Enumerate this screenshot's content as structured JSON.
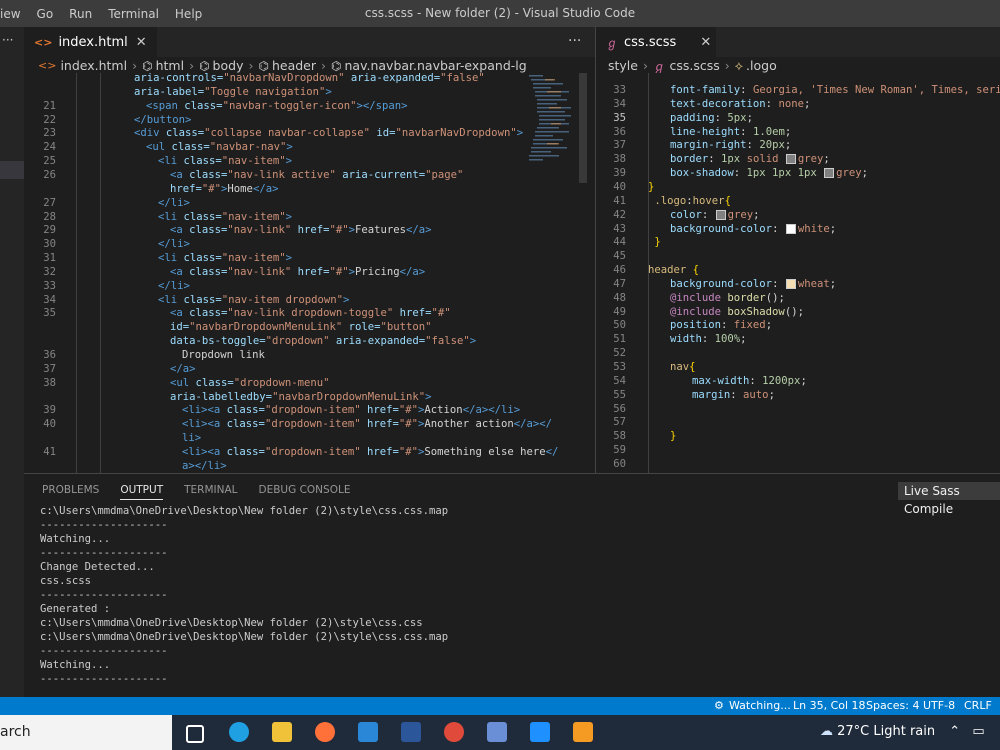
{
  "menu": [
    "iew",
    "Go",
    "Run",
    "Terminal",
    "Help"
  ],
  "window_title": "css.scss - New folder (2) - Visual Studio Code",
  "left_editor": {
    "tab_label": "index.html",
    "close_glyph": "✕",
    "more_glyph": "···",
    "breadcrumb": [
      "index.html",
      "html",
      "body",
      "header",
      "nav.navbar.navbar-expand-lg"
    ],
    "lines": [
      {
        "n": "",
        "indent": 0,
        "tokens": [
          [
            "at",
            "aria-controls="
          ],
          [
            "st",
            "\"navbarNavDropdown\""
          ],
          [
            "at",
            " aria-expanded="
          ],
          [
            "st",
            "\"false\""
          ]
        ]
      },
      {
        "n": "",
        "indent": 0,
        "tokens": [
          [
            "at",
            "aria-label="
          ],
          [
            "st",
            "\"Toggle navigation\""
          ],
          [
            "tg",
            ">"
          ]
        ]
      },
      {
        "n": "21",
        "indent": 1,
        "tokens": [
          [
            "tg",
            "<span "
          ],
          [
            "at",
            "class="
          ],
          [
            "st",
            "\"navbar-toggler-icon\""
          ],
          [
            "tg",
            "></span>"
          ]
        ]
      },
      {
        "n": "22",
        "indent": 0,
        "tokens": [
          [
            "tg",
            "</button>"
          ]
        ]
      },
      {
        "n": "23",
        "indent": 0,
        "tokens": [
          [
            "tg",
            "<div "
          ],
          [
            "at",
            "class="
          ],
          [
            "st",
            "\"collapse navbar-collapse\""
          ],
          [
            "at",
            " id="
          ],
          [
            "st",
            "\"navbarNavDropdown\""
          ],
          [
            "tg",
            ">"
          ]
        ]
      },
      {
        "n": "24",
        "indent": 1,
        "tokens": [
          [
            "tg",
            "<ul "
          ],
          [
            "at",
            "class="
          ],
          [
            "st",
            "\"navbar-nav\""
          ],
          [
            "tg",
            ">"
          ]
        ]
      },
      {
        "n": "25",
        "indent": 2,
        "tokens": [
          [
            "tg",
            "<li "
          ],
          [
            "at",
            "class="
          ],
          [
            "st",
            "\"nav-item\""
          ],
          [
            "tg",
            ">"
          ]
        ]
      },
      {
        "n": "26",
        "indent": 3,
        "tokens": [
          [
            "tg",
            "<a "
          ],
          [
            "at",
            "class="
          ],
          [
            "st",
            "\"nav-link active\""
          ],
          [
            "at",
            " aria-current="
          ],
          [
            "st",
            "\"page\""
          ]
        ]
      },
      {
        "n": "",
        "indent": 3,
        "tokens": [
          [
            "at",
            "href="
          ],
          [
            "st",
            "\"#\""
          ],
          [
            "tg",
            ">"
          ],
          [
            "pl",
            "Home"
          ],
          [
            "tg",
            "</a>"
          ]
        ]
      },
      {
        "n": "27",
        "indent": 2,
        "tokens": [
          [
            "tg",
            "</li>"
          ]
        ]
      },
      {
        "n": "28",
        "indent": 2,
        "tokens": [
          [
            "tg",
            "<li "
          ],
          [
            "at",
            "class="
          ],
          [
            "st",
            "\"nav-item\""
          ],
          [
            "tg",
            ">"
          ]
        ]
      },
      {
        "n": "29",
        "indent": 3,
        "tokens": [
          [
            "tg",
            "<a "
          ],
          [
            "at",
            "class="
          ],
          [
            "st",
            "\"nav-link\""
          ],
          [
            "at",
            " href="
          ],
          [
            "st",
            "\"#\""
          ],
          [
            "tg",
            ">"
          ],
          [
            "pl",
            "Features"
          ],
          [
            "tg",
            "</a>"
          ]
        ]
      },
      {
        "n": "30",
        "indent": 2,
        "tokens": [
          [
            "tg",
            "</li>"
          ]
        ]
      },
      {
        "n": "31",
        "indent": 2,
        "tokens": [
          [
            "tg",
            "<li "
          ],
          [
            "at",
            "class="
          ],
          [
            "st",
            "\"nav-item\""
          ],
          [
            "tg",
            ">"
          ]
        ]
      },
      {
        "n": "32",
        "indent": 3,
        "tokens": [
          [
            "tg",
            "<a "
          ],
          [
            "at",
            "class="
          ],
          [
            "st",
            "\"nav-link\""
          ],
          [
            "at",
            " href="
          ],
          [
            "st",
            "\"#\""
          ],
          [
            "tg",
            ">"
          ],
          [
            "pl",
            "Pricing"
          ],
          [
            "tg",
            "</a>"
          ]
        ]
      },
      {
        "n": "33",
        "indent": 2,
        "tokens": [
          [
            "tg",
            "</li>"
          ]
        ]
      },
      {
        "n": "34",
        "indent": 2,
        "tokens": [
          [
            "tg",
            "<li "
          ],
          [
            "at",
            "class="
          ],
          [
            "st",
            "\"nav-item dropdown\""
          ],
          [
            "tg",
            ">"
          ]
        ]
      },
      {
        "n": "35",
        "indent": 3,
        "tokens": [
          [
            "tg",
            "<a "
          ],
          [
            "at",
            "class="
          ],
          [
            "st",
            "\"nav-link dropdown-toggle\""
          ],
          [
            "at",
            " href="
          ],
          [
            "st",
            "\"#\""
          ]
        ]
      },
      {
        "n": "",
        "indent": 3,
        "tokens": [
          [
            "at",
            "id="
          ],
          [
            "st",
            "\"navbarDropdownMenuLink\""
          ],
          [
            "at",
            " role="
          ],
          [
            "st",
            "\"button\""
          ]
        ]
      },
      {
        "n": "",
        "indent": 3,
        "tokens": [
          [
            "at",
            "data-bs-toggle="
          ],
          [
            "st",
            "\"dropdown\""
          ],
          [
            "at",
            " aria-expanded="
          ],
          [
            "st",
            "\"false\""
          ],
          [
            "tg",
            ">"
          ]
        ]
      },
      {
        "n": "36",
        "indent": 4,
        "tokens": [
          [
            "pl",
            "Dropdown link"
          ]
        ]
      },
      {
        "n": "37",
        "indent": 3,
        "tokens": [
          [
            "tg",
            "</a>"
          ]
        ]
      },
      {
        "n": "38",
        "indent": 3,
        "tokens": [
          [
            "tg",
            "<ul "
          ],
          [
            "at",
            "class="
          ],
          [
            "st",
            "\"dropdown-menu\""
          ]
        ]
      },
      {
        "n": "",
        "indent": 3,
        "tokens": [
          [
            "at",
            "aria-labelledby="
          ],
          [
            "st",
            "\"navbarDropdownMenuLink\""
          ],
          [
            "tg",
            ">"
          ]
        ]
      },
      {
        "n": "39",
        "indent": 4,
        "tokens": [
          [
            "tg",
            "<li><a "
          ],
          [
            "at",
            "class="
          ],
          [
            "st",
            "\"dropdown-item\""
          ],
          [
            "at",
            " href="
          ],
          [
            "st",
            "\"#\""
          ],
          [
            "tg",
            ">"
          ],
          [
            "pl",
            "Action"
          ],
          [
            "tg",
            "</a></li>"
          ]
        ]
      },
      {
        "n": "40",
        "indent": 4,
        "tokens": [
          [
            "tg",
            "<li><a "
          ],
          [
            "at",
            "class="
          ],
          [
            "st",
            "\"dropdown-item\""
          ],
          [
            "at",
            " href="
          ],
          [
            "st",
            "\"#\""
          ],
          [
            "tg",
            ">"
          ],
          [
            "pl",
            "Another action"
          ],
          [
            "tg",
            "</a></"
          ]
        ]
      },
      {
        "n": "",
        "indent": 4,
        "tokens": [
          [
            "tg",
            "li>"
          ]
        ]
      },
      {
        "n": "41",
        "indent": 4,
        "tokens": [
          [
            "tg",
            "<li><a "
          ],
          [
            "at",
            "class="
          ],
          [
            "st",
            "\"dropdown-item\""
          ],
          [
            "at",
            " href="
          ],
          [
            "st",
            "\"#\""
          ],
          [
            "tg",
            ">"
          ],
          [
            "pl",
            "Something else here"
          ],
          [
            "tg",
            "</"
          ]
        ]
      },
      {
        "n": "",
        "indent": 4,
        "tokens": [
          [
            "tg",
            "a></li>"
          ]
        ]
      }
    ]
  },
  "right_editor": {
    "tab_label": "css.scss",
    "close_glyph": "✕",
    "breadcrumb": [
      "style",
      "css.scss",
      ".logo"
    ],
    "lines": [
      {
        "n": "33",
        "indent": 1,
        "tokens": [
          [
            "prop",
            "font-family"
          ],
          [
            "pl",
            ": "
          ],
          [
            "val",
            "Georgia, 'Times New Roman', Times, serif"
          ],
          [
            "pl",
            ";"
          ]
        ]
      },
      {
        "n": "34",
        "indent": 1,
        "tokens": [
          [
            "prop",
            "text-decoration"
          ],
          [
            "pl",
            ": "
          ],
          [
            "val",
            "none"
          ],
          [
            "pl",
            ";"
          ]
        ]
      },
      {
        "n": "35",
        "indent": 1,
        "tokens": [
          [
            "prop",
            "padding"
          ],
          [
            "pl",
            ": "
          ],
          [
            "num",
            "5px"
          ],
          [
            "pl",
            ";"
          ]
        ]
      },
      {
        "n": "36",
        "indent": 1,
        "tokens": [
          [
            "prop",
            "line-height"
          ],
          [
            "pl",
            ": "
          ],
          [
            "num",
            "1.0em"
          ],
          [
            "pl",
            ";"
          ]
        ]
      },
      {
        "n": "37",
        "indent": 1,
        "tokens": [
          [
            "prop",
            "margin-right"
          ],
          [
            "pl",
            ": "
          ],
          [
            "num",
            "20px"
          ],
          [
            "pl",
            ";"
          ]
        ]
      },
      {
        "n": "38",
        "indent": 1,
        "tokens": [
          [
            "prop",
            "border"
          ],
          [
            "pl",
            ": "
          ],
          [
            "num",
            "1px "
          ],
          [
            "val",
            "solid "
          ],
          [
            "swatch",
            "#808080"
          ],
          [
            "val",
            "grey"
          ],
          [
            "pl",
            ";"
          ]
        ]
      },
      {
        "n": "39",
        "indent": 1,
        "tokens": [
          [
            "prop",
            "box-shadow"
          ],
          [
            "pl",
            ": "
          ],
          [
            "num",
            "1px 1px 1px "
          ],
          [
            "swatch",
            "#808080"
          ],
          [
            "val",
            "grey"
          ],
          [
            "pl",
            ";"
          ]
        ]
      },
      {
        "n": "40",
        "indent": 0,
        "tokens": [
          [
            "br",
            "}"
          ]
        ]
      },
      {
        "n": "41",
        "indent": 0,
        "tokens": [
          [
            "sel",
            " .logo"
          ],
          [
            "pl",
            ":"
          ],
          [
            "sel",
            "hover"
          ],
          [
            "br",
            "{"
          ]
        ]
      },
      {
        "n": "42",
        "indent": 1,
        "tokens": [
          [
            "prop",
            "color"
          ],
          [
            "pl",
            ": "
          ],
          [
            "swatch",
            "#808080"
          ],
          [
            "val",
            "grey"
          ],
          [
            "pl",
            ";"
          ]
        ]
      },
      {
        "n": "43",
        "indent": 1,
        "tokens": [
          [
            "prop",
            "background-color"
          ],
          [
            "pl",
            ": "
          ],
          [
            "swatch",
            "#ffffff"
          ],
          [
            "val",
            "white"
          ],
          [
            "pl",
            ";"
          ]
        ]
      },
      {
        "n": "44",
        "indent": 0,
        "tokens": [
          [
            "br",
            " }"
          ]
        ]
      },
      {
        "n": "45",
        "indent": 0,
        "tokens": []
      },
      {
        "n": "46",
        "indent": 0,
        "tokens": [
          [
            "sel",
            "header "
          ],
          [
            "br",
            "{"
          ]
        ]
      },
      {
        "n": "47",
        "indent": 1,
        "tokens": [
          [
            "prop",
            "background-color"
          ],
          [
            "pl",
            ": "
          ],
          [
            "swatch",
            "#f5deb3"
          ],
          [
            "val",
            "wheat"
          ],
          [
            "pl",
            ";"
          ]
        ]
      },
      {
        "n": "48",
        "indent": 1,
        "tokens": [
          [
            "kw",
            "@include "
          ],
          [
            "fn",
            "border"
          ],
          [
            "pl",
            "();"
          ]
        ]
      },
      {
        "n": "49",
        "indent": 1,
        "tokens": [
          [
            "kw",
            "@include "
          ],
          [
            "fn",
            "boxShadow"
          ],
          [
            "pl",
            "();"
          ]
        ]
      },
      {
        "n": "50",
        "indent": 1,
        "tokens": [
          [
            "prop",
            "position"
          ],
          [
            "pl",
            ": "
          ],
          [
            "val",
            "fixed"
          ],
          [
            "pl",
            ";"
          ]
        ]
      },
      {
        "n": "51",
        "indent": 1,
        "tokens": [
          [
            "prop",
            "width"
          ],
          [
            "pl",
            ": "
          ],
          [
            "num",
            "100%"
          ],
          [
            "pl",
            ";"
          ]
        ]
      },
      {
        "n": "52",
        "indent": 0,
        "tokens": []
      },
      {
        "n": "53",
        "indent": 1,
        "tokens": [
          [
            "sel",
            "nav"
          ],
          [
            "br",
            "{"
          ]
        ]
      },
      {
        "n": "54",
        "indent": 2,
        "tokens": [
          [
            "prop",
            "max-width"
          ],
          [
            "pl",
            ": "
          ],
          [
            "num",
            "1200px"
          ],
          [
            "pl",
            ";"
          ]
        ]
      },
      {
        "n": "55",
        "indent": 2,
        "tokens": [
          [
            "prop",
            "margin"
          ],
          [
            "pl",
            ": "
          ],
          [
            "val",
            "auto"
          ],
          [
            "pl",
            ";"
          ]
        ]
      },
      {
        "n": "56",
        "indent": 0,
        "tokens": []
      },
      {
        "n": "57",
        "indent": 0,
        "tokens": []
      },
      {
        "n": "58",
        "indent": 1,
        "tokens": [
          [
            "br",
            "}"
          ]
        ]
      },
      {
        "n": "59",
        "indent": 0,
        "tokens": []
      },
      {
        "n": "60",
        "indent": 0,
        "tokens": []
      }
    ]
  },
  "panel": {
    "tabs": [
      "PROBLEMS",
      "OUTPUT",
      "TERMINAL",
      "DEBUG CONSOLE"
    ],
    "active_tab": "OUTPUT",
    "channel": "Live Sass Compile",
    "output": [
      "c:\\Users\\mmdma\\OneDrive\\Desktop\\New folder (2)\\style\\css.css.map",
      "--------------------",
      "Watching...",
      "--------------------",
      "Change Detected...",
      "css.scss",
      "--------------------",
      "Generated :",
      "c:\\Users\\mmdma\\OneDrive\\Desktop\\New folder (2)\\style\\css.css",
      "c:\\Users\\mmdma\\OneDrive\\Desktop\\New folder (2)\\style\\css.css.map",
      "--------------------",
      "Watching...",
      "--------------------"
    ]
  },
  "statusbar": {
    "watching": "Watching...",
    "cursor": "Ln 35, Col 18",
    "spaces": "Spaces: 4",
    "encoding": "UTF-8",
    "eol": "CRLF"
  },
  "taskbar": {
    "search_text": "arch",
    "weather": "27°C  Light rain",
    "app_icons": [
      {
        "name": "task-view",
        "color": "#ffffff"
      },
      {
        "name": "edge",
        "color": "#1fa0e3"
      },
      {
        "name": "file-explorer",
        "color": "#f0c23a"
      },
      {
        "name": "firefox",
        "color": "#ff7139"
      },
      {
        "name": "mail",
        "color": "#2a86d6"
      },
      {
        "name": "word",
        "color": "#2b579a"
      },
      {
        "name": "chrome",
        "color": "#e04a3a"
      },
      {
        "name": "app-blue",
        "color": "#6a8fd6"
      },
      {
        "name": "vscode",
        "color": "#1e90ff"
      },
      {
        "name": "app-orange",
        "color": "#f59a23"
      }
    ]
  },
  "colors": {
    "statusbar": "#007acc",
    "editor_bg": "#1e1e1e",
    "titlebar": "#3c3c3c"
  }
}
